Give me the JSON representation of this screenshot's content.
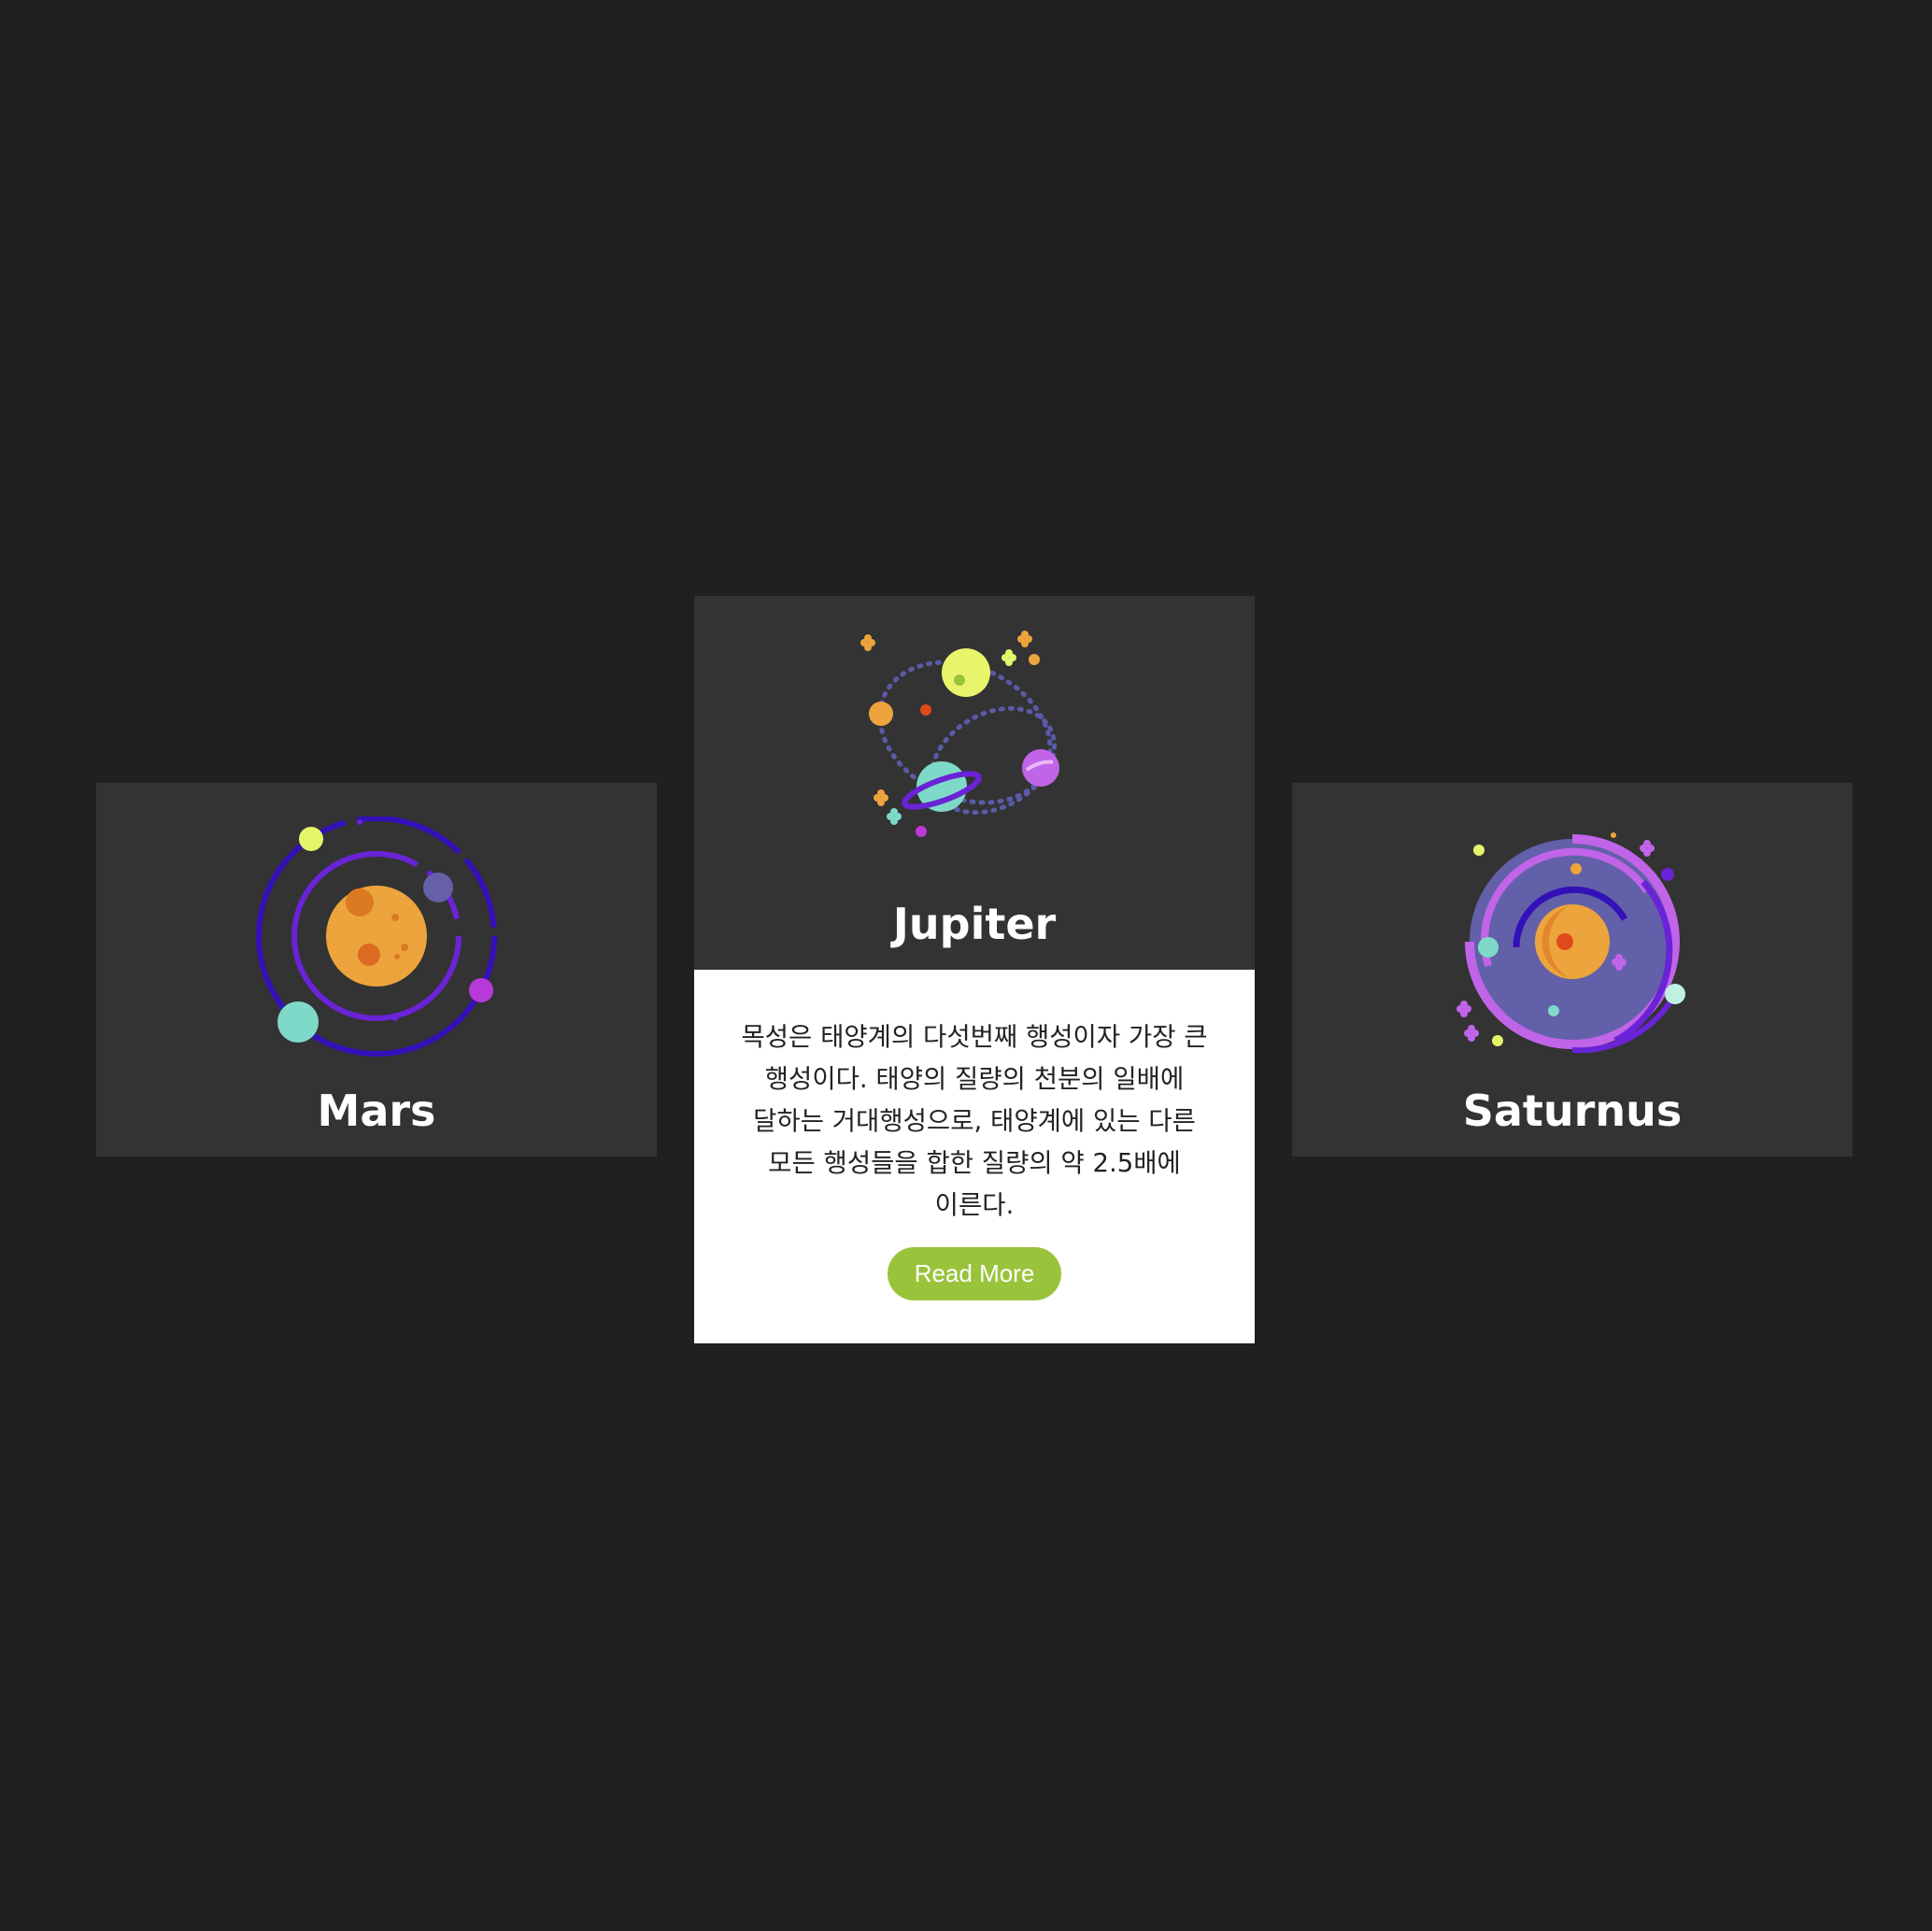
{
  "cards": [
    {
      "title": "Mars",
      "icon": "solar-system-orbit-icon"
    },
    {
      "title": "Jupiter",
      "icon": "planets-dotted-orbits-icon",
      "description": "목성은 태양계의 다섯번째 행성이자 가장 큰 행성이다. 태양의 질량의 천분의 일배에 달하는 거대행성으로, 태양계에 있는 다른 모든 행성들을 합한 질량의 약 2.5배에 이른다.",
      "button_label": "Read More"
    },
    {
      "title": "Saturnus",
      "icon": "galaxy-spiral-icon"
    }
  ],
  "colors": {
    "page_background": "#202020",
    "card_background": "#333333",
    "button_background": "#9ac33c"
  }
}
